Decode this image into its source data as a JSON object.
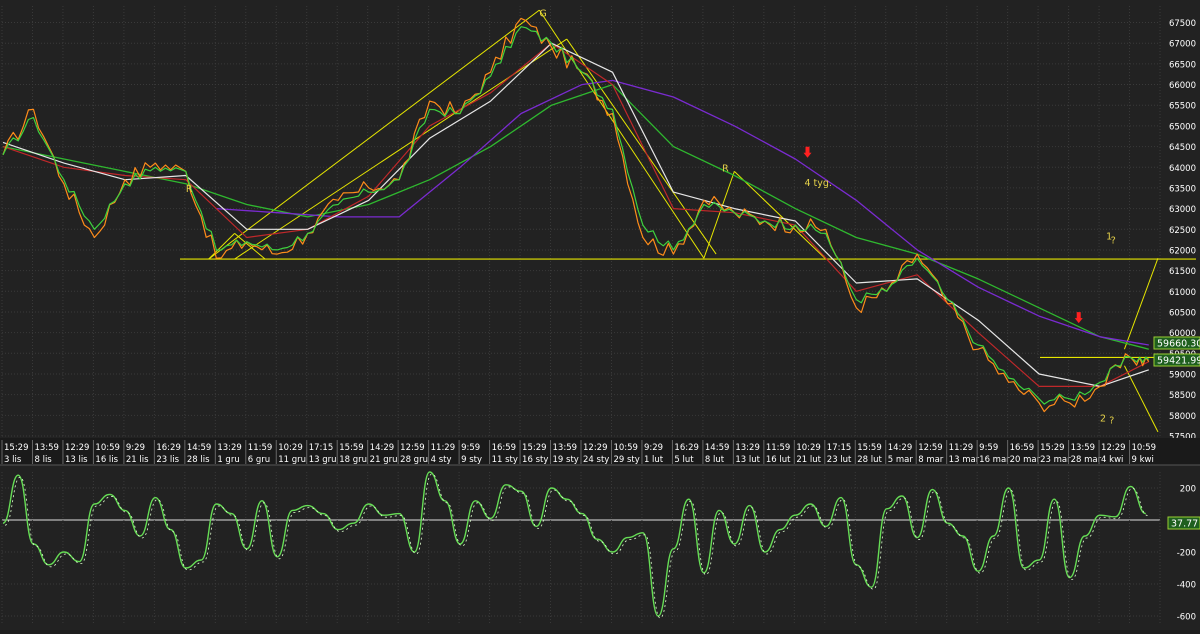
{
  "colors": {
    "background": "#222222",
    "grid": "#3a3a3a",
    "price_orange": "#ff8c1a",
    "fast_green": "#3ed23e",
    "ma_red": "#c0282a",
    "ma_white": "#e6e6e6",
    "ma_mid_green": "#2fb82f",
    "ma_purple": "#7a2bd0",
    "trendline_yellow": "#e6e600",
    "oscillator": "#66dd55",
    "signal_arrow": "#ff2020",
    "axis_text": "#ffffff",
    "annotation_text": "#e6d24a"
  },
  "chart_data": [
    {
      "type": "line",
      "panel": "price",
      "ylim": [
        57500,
        67900
      ],
      "y_ticks": [
        57500,
        58000,
        58500,
        59000,
        59500,
        60000,
        60500,
        61000,
        61500,
        62000,
        62500,
        63000,
        63500,
        64000,
        64500,
        65000,
        65500,
        66000,
        66500,
        67000,
        67500
      ],
      "x_labels_time": [
        "15:29",
        "13:59",
        "12:29",
        "10:59",
        "9:29",
        "16:29",
        "14:59",
        "13:29",
        "11:59",
        "10:29",
        "17:15",
        "15:59",
        "14:29",
        "12:59",
        "11:29",
        "9:59",
        "16:59",
        "15:29",
        "13:59",
        "12:29",
        "10:59",
        "9:29",
        "16:29",
        "14:59",
        "13:29",
        "11:59",
        "10:29",
        "17:15",
        "15:59",
        "14:29",
        "12:59",
        "11:29",
        "9:59",
        "16:59",
        "15:29",
        "13:59",
        "12:29",
        "10:59"
      ],
      "x_labels_date": [
        "3 lis",
        "8 lis",
        "13 lis",
        "16 lis",
        "21 lis",
        "23 lis",
        "28 lis",
        "1 gru",
        "6 gru",
        "11 gru",
        "13 gru",
        "18 gru",
        "21 gru",
        "28 gru",
        "4 sty",
        "9 sty",
        "11 sty",
        "16 sty",
        "19 sty",
        "24 sty",
        "29 sty",
        "1 lut",
        "5 lut",
        "8 lut",
        "13 lut",
        "16 lut",
        "21 lut",
        "23 lut",
        "28 lut",
        "5 mar",
        "8 mar",
        "13 mar",
        "16 mar",
        "20 mar",
        "23 mar",
        "28 mar",
        "4 kwi",
        "9 kwi"
      ],
      "series": [
        {
          "color_key": "price_orange",
          "x": [
            0,
            1,
            2,
            3,
            4,
            5,
            6,
            7,
            8,
            9,
            10,
            11,
            12,
            13,
            14,
            15,
            16,
            17,
            18,
            19,
            20,
            21,
            22,
            23,
            24,
            25,
            26,
            27,
            28,
            29,
            30,
            31,
            32,
            33,
            34,
            35,
            36,
            37,
            37.6
          ],
          "values": [
            64300,
            65400,
            63600,
            62300,
            63700,
            64100,
            63900,
            61800,
            62200,
            61900,
            62400,
            63200,
            63500,
            63700,
            65600,
            65300,
            66300,
            67600,
            66900,
            66300,
            65300,
            62300,
            61900,
            63200,
            62900,
            62700,
            62600,
            62500,
            60600,
            61000,
            61900,
            60700,
            59600,
            58800,
            58300,
            58300,
            58700,
            59400,
            59300
          ]
        },
        {
          "color_key": "fast_green",
          "x": [
            0,
            1,
            2,
            3,
            4,
            5,
            6,
            7,
            8,
            9,
            10,
            11,
            12,
            13,
            14,
            15,
            16,
            17,
            18,
            19,
            20,
            21,
            22,
            23,
            24,
            25,
            26,
            27,
            28,
            29,
            30,
            31,
            32,
            33,
            34,
            35,
            36,
            37,
            37.6
          ],
          "values": [
            64300,
            65200,
            63700,
            62500,
            63600,
            64000,
            63900,
            62000,
            62200,
            62000,
            62400,
            63100,
            63400,
            63700,
            65400,
            65300,
            66200,
            67400,
            67000,
            66300,
            65400,
            62600,
            62000,
            63100,
            62900,
            62700,
            62600,
            62400,
            60800,
            61000,
            61800,
            60800,
            59700,
            58900,
            58400,
            58400,
            58800,
            59400,
            59350
          ]
        },
        {
          "color_key": "ma_red",
          "x": [
            0,
            2,
            4,
            6,
            8,
            10,
            12,
            14,
            16,
            18,
            20,
            22,
            24,
            26,
            28,
            30,
            32,
            34,
            36,
            37.6
          ],
          "values": [
            64500,
            64000,
            63800,
            63700,
            62300,
            62500,
            63300,
            65000,
            65800,
            67000,
            66000,
            63000,
            62900,
            62600,
            61000,
            61400,
            60000,
            58700,
            58700,
            59300
          ]
        },
        {
          "color_key": "ma_white",
          "x": [
            0,
            2,
            4,
            6,
            8,
            10,
            12,
            14,
            16,
            18,
            20,
            22,
            24,
            26,
            28,
            30,
            32,
            34,
            36,
            37.6
          ],
          "values": [
            64600,
            64100,
            63700,
            63800,
            62500,
            62500,
            63200,
            64700,
            65600,
            67000,
            66300,
            63400,
            63000,
            62700,
            61200,
            61300,
            60300,
            59000,
            58700,
            59100
          ]
        },
        {
          "color_key": "ma_mid_green",
          "x": [
            0,
            2,
            4,
            6,
            8,
            10,
            12,
            14,
            16,
            18,
            20,
            22,
            24,
            26,
            28,
            30,
            32,
            34,
            36,
            37.6
          ],
          "values": [
            64500,
            64200,
            63900,
            63600,
            63100,
            62800,
            63100,
            63700,
            64500,
            65500,
            66000,
            64500,
            63800,
            63000,
            62300,
            61900,
            61300,
            60600,
            59900,
            59600
          ]
        },
        {
          "color_key": "ma_purple",
          "x": [
            7,
            9,
            11,
            13,
            15,
            17,
            19,
            20,
            22,
            24,
            26,
            28,
            30,
            32,
            34,
            36,
            37.6
          ],
          "values": [
            63000,
            62900,
            62800,
            62800,
            64000,
            65300,
            66000,
            66100,
            65700,
            65000,
            64200,
            63200,
            62000,
            61100,
            60400,
            59900,
            59700
          ]
        }
      ],
      "markers": [
        {
          "label": "G",
          "x": 17.6,
          "value": 67650
        },
        {
          "label": "R",
          "x": 6.0,
          "value": 63400
        },
        {
          "label": "R",
          "x": 23.6,
          "value": 63900
        },
        {
          "label": "4 tyg.",
          "x": 26.3,
          "value": 63550
        },
        {
          "label": "1",
          "x": 36.2,
          "value": 62250
        },
        {
          "label": "?",
          "x": 36.35,
          "value": 62150
        },
        {
          "label": "2",
          "x": 36.0,
          "value": 57850
        },
        {
          "label": "?",
          "x": 36.3,
          "value": 57800
        }
      ],
      "arrows": [
        {
          "x": 26.4,
          "value": 64350
        },
        {
          "x": 35.3,
          "value": 60350
        }
      ],
      "horizontal_lines": [
        61780,
        59400
      ],
      "price_labels": [
        "59660.30",
        "59421.99"
      ]
    },
    {
      "type": "line",
      "panel": "oscillator",
      "ylim": [
        -650,
        300
      ],
      "y_ticks": [
        -600,
        -400,
        -200,
        0,
        200
      ],
      "current_value_label": "37.77",
      "series": [
        {
          "color_key": "oscillator",
          "x": [
            0,
            0.5,
            1,
            1.5,
            2,
            2.5,
            3,
            3.5,
            4,
            4.5,
            5,
            5.5,
            6,
            6.5,
            7,
            7.5,
            8,
            8.5,
            9,
            9.5,
            10,
            10.5,
            11,
            11.5,
            12,
            12.5,
            13,
            13.5,
            14,
            14.5,
            15,
            15.5,
            16,
            16.5,
            17,
            17.5,
            18,
            18.5,
            19,
            19.5,
            20,
            20.5,
            21,
            21.5,
            22,
            22.5,
            23,
            23.5,
            24,
            24.5,
            25,
            25.5,
            26,
            26.5,
            27,
            27.5,
            28,
            28.5,
            29,
            29.5,
            30,
            30.5,
            31,
            31.5,
            32,
            32.5,
            33,
            33.5,
            34,
            34.5,
            35,
            35.5,
            36,
            36.5,
            37,
            37.5
          ],
          "values": [
            -20,
            280,
            -150,
            -280,
            -200,
            -260,
            100,
            160,
            60,
            -100,
            140,
            -60,
            -300,
            -250,
            100,
            40,
            -180,
            120,
            -230,
            60,
            90,
            40,
            -60,
            -20,
            100,
            30,
            40,
            -200,
            300,
            120,
            -150,
            120,
            10,
            220,
            180,
            -40,
            200,
            130,
            40,
            -120,
            -200,
            -110,
            -80,
            -600,
            -180,
            130,
            -330,
            60,
            -150,
            90,
            -200,
            -60,
            30,
            100,
            -40,
            140,
            -280,
            -420,
            70,
            150,
            -110,
            190,
            -20,
            -100,
            -320,
            -100,
            200,
            -300,
            -250,
            130,
            -360,
            -100,
            30,
            20,
            210,
            40
          ]
        }
      ]
    }
  ]
}
